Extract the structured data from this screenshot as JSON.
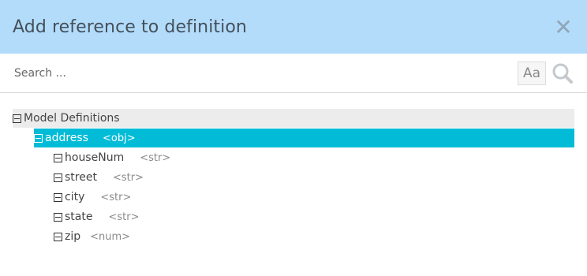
{
  "dialog": {
    "title": "Add reference to definition",
    "close_glyph": "✕"
  },
  "search": {
    "placeholder": "Search ...",
    "case_label": "Aa"
  },
  "tree": {
    "root_label": "Model Definitions",
    "object": {
      "name": "address",
      "type": "<obj>"
    },
    "fields": [
      {
        "name": "houseNum",
        "type": "<str>"
      },
      {
        "name": "street",
        "type": "<str>"
      },
      {
        "name": "city",
        "type": "<str>"
      },
      {
        "name": "state",
        "type": "<str>"
      },
      {
        "name": "zip",
        "type": "<num>"
      }
    ]
  },
  "colors": {
    "header_bg": "#b3dcfb",
    "selected_bg": "#02bcd7",
    "root_bg": "#ececec"
  },
  "icons": [
    "close-icon",
    "search-icon",
    "case-sensitive-icon",
    "collapse-icon"
  ]
}
